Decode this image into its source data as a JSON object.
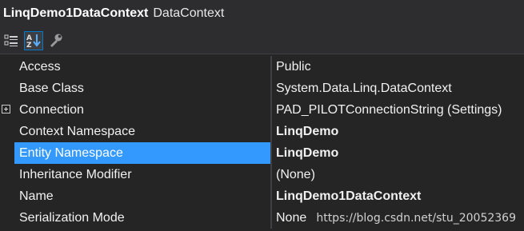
{
  "header": {
    "object_name": "LinqDemo1DataContext",
    "object_type": "DataContext"
  },
  "toolbar": {
    "buttons": [
      {
        "icon": "categorized-icon",
        "active": false
      },
      {
        "icon": "alphabetical-icon",
        "active": true
      },
      {
        "icon": "property-pages-icon",
        "active": false
      }
    ]
  },
  "properties": [
    {
      "name": "Access",
      "value": "Public",
      "bold": false,
      "expandable": false,
      "selected": false
    },
    {
      "name": "Base Class",
      "value": "System.Data.Linq.DataContext",
      "bold": false,
      "expandable": false,
      "selected": false
    },
    {
      "name": "Connection",
      "value": "PAD_PILOTConnectionString (Settings)",
      "bold": false,
      "expandable": true,
      "selected": false
    },
    {
      "name": "Context Namespace",
      "value": "LinqDemo",
      "bold": true,
      "expandable": false,
      "selected": false
    },
    {
      "name": "Entity Namespace",
      "value": "LinqDemo",
      "bold": true,
      "expandable": false,
      "selected": true
    },
    {
      "name": "Inheritance Modifier",
      "value": "(None)",
      "bold": false,
      "expandable": false,
      "selected": false
    },
    {
      "name": "Name",
      "value": "LinqDemo1DataContext",
      "bold": true,
      "expandable": false,
      "selected": false
    },
    {
      "name": "Serialization Mode",
      "value": "None",
      "bold": false,
      "expandable": false,
      "selected": false
    }
  ],
  "watermark": "https://blog.csdn.net/stu_20052369",
  "colors": {
    "background": "#252526",
    "selection": "#3399ff",
    "toolbar_active_border": "#007acc"
  }
}
